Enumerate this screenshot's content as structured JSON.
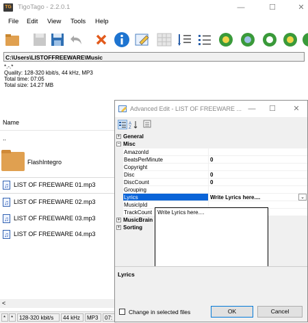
{
  "window": {
    "title": "TigoTago - 2.2.0.1",
    "app_icon_text": "TG",
    "minimize": "—",
    "maximize": "☐",
    "close": "✕"
  },
  "menu": {
    "items": [
      "File",
      "Edit",
      "View",
      "Tools",
      "Help"
    ]
  },
  "path": "C:\\Users\\LISTOFFREEWARE\\Music",
  "info": {
    "line1": "*.-.*",
    "line2": "Quality: 128-320 kbit/s, 44 kHz, MP3",
    "line3": "Total time: 07:05",
    "line4": "Total size: 14.27 MB"
  },
  "list": {
    "header": "Name",
    "parent": "..",
    "folder": "FlashIntegro",
    "files": [
      "LIST OF FREEWARE 01.mp3",
      "LIST OF FREEWARE 02.mp3",
      "LIST OF FREEWARE 03.mp3",
      "LIST OF FREEWARE 04.mp3"
    ]
  },
  "scroll": {
    "left": "<"
  },
  "status": {
    "c1": "*",
    "c2": "*",
    "c3": "128-320 kbit/s",
    "c4": "44 kHz",
    "c5": "MP3",
    "c6": "07:"
  },
  "dialog": {
    "title": "Advanced Edit - LIST OF FREEWARE ...",
    "minimize": "—",
    "maximize": "☐",
    "close": "✕",
    "categories": {
      "general": "General",
      "misc": "Misc",
      "musicbrainz": "MusicBrain",
      "sorting": "Sorting"
    },
    "props": {
      "amazonid": "AmazonId",
      "bpm": "BeatsPerMinute",
      "bpm_val": "0",
      "copyright": "Copyright",
      "disc": "Disc",
      "disc_val": "0",
      "disccount": "DiscCount",
      "disccount_val": "0",
      "grouping": "Grouping",
      "lyrics": "Lyrics",
      "lyrics_val": "Write Lyrics here....",
      "musicipid": "MusicIpId",
      "trackcount": "TrackCount"
    },
    "dropdown_text": "Write Lyrics here....",
    "help_title": "Lyrics",
    "change_in_selected": "Change in selected files",
    "ok": "OK",
    "cancel": "Cancel"
  }
}
